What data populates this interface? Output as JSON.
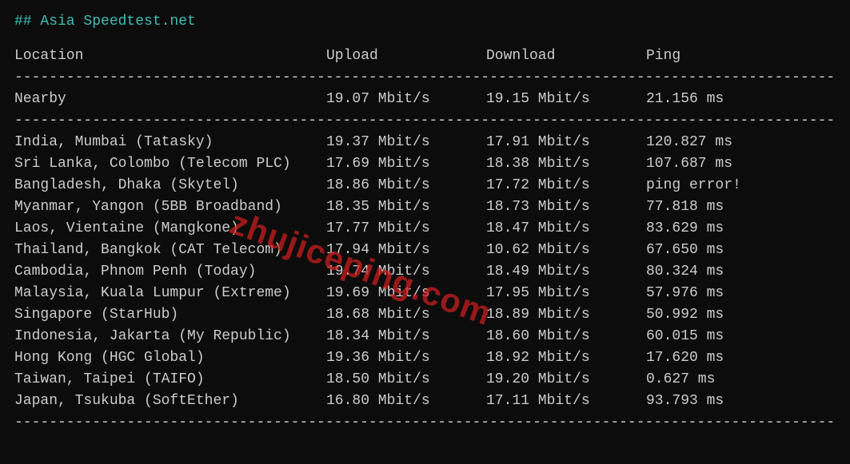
{
  "title": "## Asia Speedtest.net",
  "headers": {
    "location": "Location",
    "upload": "Upload",
    "download": "Download",
    "ping": "Ping"
  },
  "nearby": {
    "location": "Nearby",
    "upload": "19.07 Mbit/s",
    "download": "19.15 Mbit/s",
    "ping": "21.156 ms"
  },
  "rows": [
    {
      "location": "India, Mumbai (Tatasky)",
      "upload": "19.37 Mbit/s",
      "download": "17.91 Mbit/s",
      "ping": "120.827 ms"
    },
    {
      "location": "Sri Lanka, Colombo (Telecom PLC)",
      "upload": "17.69 Mbit/s",
      "download": "18.38 Mbit/s",
      "ping": "107.687 ms"
    },
    {
      "location": "Bangladesh, Dhaka (Skytel)",
      "upload": "18.86 Mbit/s",
      "download": "17.72 Mbit/s",
      "ping": "ping error!"
    },
    {
      "location": "Myanmar, Yangon (5BB Broadband)",
      "upload": "18.35 Mbit/s",
      "download": "18.73 Mbit/s",
      "ping": "77.818 ms"
    },
    {
      "location": "Laos, Vientaine (Mangkone)",
      "upload": "17.77 Mbit/s",
      "download": "18.47 Mbit/s",
      "ping": "83.629 ms"
    },
    {
      "location": "Thailand, Bangkok (CAT Telecom)",
      "upload": "17.94 Mbit/s",
      "download": "10.62 Mbit/s",
      "ping": "67.650 ms"
    },
    {
      "location": "Cambodia, Phnom Penh (Today)",
      "upload": "19.74 Mbit/s",
      "download": "18.49 Mbit/s",
      "ping": "80.324 ms"
    },
    {
      "location": "Malaysia, Kuala Lumpur (Extreme)",
      "upload": "19.69 Mbit/s",
      "download": "17.95 Mbit/s",
      "ping": "57.976 ms"
    },
    {
      "location": "Singapore (StarHub)",
      "upload": "18.68 Mbit/s",
      "download": "18.89 Mbit/s",
      "ping": "50.992 ms"
    },
    {
      "location": "Indonesia, Jakarta (My Republic)",
      "upload": "18.34 Mbit/s",
      "download": "18.60 Mbit/s",
      "ping": "60.015 ms"
    },
    {
      "location": "Hong Kong (HGC Global)",
      "upload": "19.36 Mbit/s",
      "download": "18.92 Mbit/s",
      "ping": "17.620 ms"
    },
    {
      "location": "Taiwan, Taipei (TAIFO)",
      "upload": "18.50 Mbit/s",
      "download": "19.20 Mbit/s",
      "ping": "0.627 ms"
    },
    {
      "location": "Japan, Tsukuba (SoftEther)",
      "upload": "16.80 Mbit/s",
      "download": "17.11 Mbit/s",
      "ping": "93.793 ms"
    }
  ],
  "watermark": "zhujiceping.com",
  "divider": "----------------------------------------------------------------------------------------------------"
}
